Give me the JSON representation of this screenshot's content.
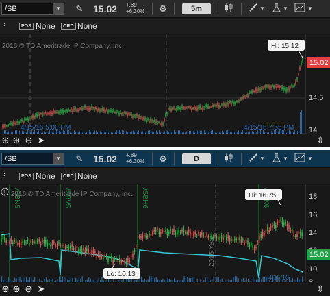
{
  "top": {
    "symbol": "/SB",
    "price": "15.02",
    "change_abs": "+.89",
    "change_pct": "+6.30%",
    "period": "5m",
    "pos_tag": "POS",
    "pos_value": "None",
    "ord_tag": "ORD",
    "ord_value": "None",
    "copyright": "2016 © TD Ameritrade IP Company, Inc.",
    "hi_label": "Hi: 15.12",
    "price_tag": "15.02",
    "y_ticks": [
      "14.5",
      "14"
    ],
    "date_left": "4/15/16 5:00 PM",
    "date_right": "4/15/16 7:55 PM"
  },
  "bottom": {
    "symbol": "/SB",
    "price": "15.02",
    "change_abs": "+.89",
    "change_pct": "+6.30%",
    "period": "D",
    "pos_tag": "POS",
    "pos_value": "None",
    "ord_tag": "ORD",
    "ord_value": "None",
    "copyright": "2016 © TD Ameritrade IP Company, Inc.",
    "hi_label": "Hi: 16.75",
    "lo_label": "Lo: 10.13",
    "price_tag": "15.02",
    "y_ticks": [
      "18",
      "16",
      "14",
      "12",
      "10",
      "8"
    ],
    "contract_labels": [
      "/SBN5",
      "/SBV5",
      "/SBH6",
      "/SBK6"
    ],
    "year_label": "2015 Year",
    "date_right": "4/15/16"
  },
  "colors": {
    "candle_up": "#2bb84a",
    "candle_down": "#e05555",
    "volume": "#2a6aa8",
    "curve": "#39c6d6",
    "price_tag_top": "#e04040",
    "price_tag_bottom": "#21a14a"
  },
  "icons": {
    "toolbar": [
      "ruler-icon",
      "gear-icon",
      "candles-icon",
      "pencil-icon",
      "flask-icon",
      "trendline-icon",
      "menu-chevron-icon"
    ],
    "footer": [
      "crosshair-icon",
      "zoom-in-icon",
      "zoom-out-icon",
      "pointer-icon",
      "expand-icon"
    ]
  }
}
